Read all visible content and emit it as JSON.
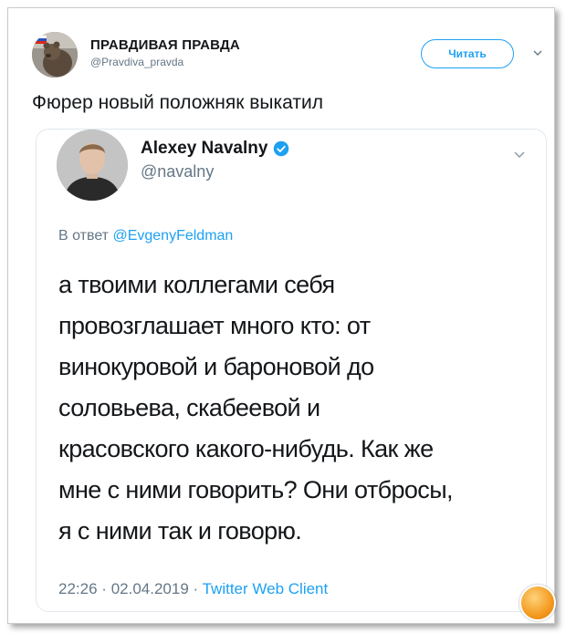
{
  "tweet": {
    "author_name": "ПРАВДИВАЯ ПРАВДА",
    "author_handle": "@Pravdiva_pravda",
    "follow_label": "Читать",
    "text": "Фюрер новый положняк выкатил"
  },
  "quoted": {
    "name": "Alexey Navalny",
    "handle": "@navalny",
    "reply_prefix": "В ответ",
    "reply_mention": "@EvgenyFeldman",
    "body_lines": [
      "а твоими коллегами себя",
      "провозглашает много кто: от",
      "винокуровой и бароновой до",
      "соловьева, скабеевой и",
      "красовского какого-нибудь. Как же",
      "мне с ними говорить? Они отбросы,",
      "я с ними так и говорю."
    ],
    "time": "22:26",
    "date": "02.04.2019",
    "separator": "·",
    "source": "Twitter Web Client"
  },
  "colors": {
    "accent": "#1da1f2",
    "muted": "#657786",
    "text": "#14171a"
  },
  "icons": {
    "verified": "verified-check-icon",
    "menu": "chevron-down-icon"
  }
}
